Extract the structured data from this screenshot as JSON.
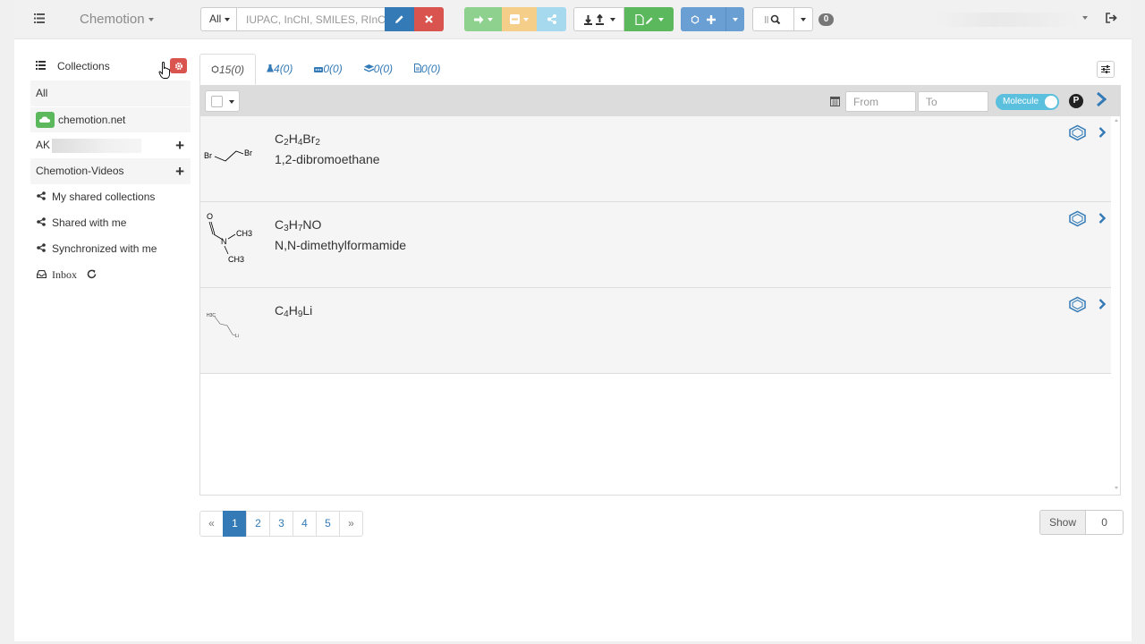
{
  "navbar": {
    "brand": "Chemotion",
    "search": {
      "scope": "All",
      "placeholder": "IUPAC, InChI, SMILES, RInChI..."
    },
    "notification_count": "0",
    "icons": {
      "menu": "menu-icon",
      "edit": "pencil-icon",
      "clear": "times-icon",
      "move": "arrow-right-icon",
      "remove": "minus-square-icon",
      "share": "share-icon",
      "import": "import-export-icon",
      "report": "file-pencil-icon",
      "create": "plus-icon",
      "search": "search-icon",
      "logout": "sign-out-icon"
    }
  },
  "sidebar": {
    "title": "Collections",
    "items": [
      {
        "label": "All"
      },
      {
        "label": "chemotion.net"
      },
      {
        "label": "AK"
      },
      {
        "label": "Chemotion-Videos"
      }
    ],
    "shared": [
      {
        "label": "My shared collections"
      },
      {
        "label": "Shared with me"
      },
      {
        "label": "Synchronized with me"
      }
    ],
    "inbox": "Inbox"
  },
  "tabs": [
    {
      "label": "15(0)",
      "icon": "sample-icon"
    },
    {
      "label": "4(0)",
      "icon": "reaction-icon"
    },
    {
      "label": "0(0)",
      "icon": "wellplate-icon"
    },
    {
      "label": "0(0)",
      "icon": "screen-icon"
    },
    {
      "label": "0(0)",
      "icon": "research-plan-icon"
    }
  ],
  "filter": {
    "from_placeholder": "From",
    "to_placeholder": "To",
    "toggle_label": "Molecule",
    "p_badge": "P"
  },
  "molecules": [
    {
      "formula": [
        [
          "C",
          ""
        ],
        [
          "",
          "2"
        ],
        [
          "H",
          ""
        ],
        [
          "",
          "4"
        ],
        [
          "Br",
          ""
        ],
        [
          "",
          "2"
        ]
      ],
      "name": "1,2-dibromoethane"
    },
    {
      "formula": [
        [
          "C",
          ""
        ],
        [
          "",
          "3"
        ],
        [
          "H",
          ""
        ],
        [
          "",
          "7"
        ],
        [
          "NO",
          ""
        ]
      ],
      "name": "N,N-dimethylformamide"
    },
    {
      "formula": [
        [
          "C",
          ""
        ],
        [
          "",
          "4"
        ],
        [
          "H",
          ""
        ],
        [
          "",
          "9"
        ],
        [
          "Li",
          ""
        ]
      ],
      "name": ""
    }
  ],
  "structure_labels": {
    "dbe": [
      "Br",
      "Br"
    ],
    "dmf": [
      "O",
      "N",
      "CH3",
      "CH3"
    ],
    "buli": [
      "H3C",
      "Li"
    ]
  },
  "pagination": [
    "«",
    "1",
    "2",
    "3",
    "4",
    "5",
    "»"
  ],
  "pagination_active": "1",
  "show": {
    "label": "Show",
    "value": "0"
  },
  "colors": {
    "primary": "#337ab7",
    "danger": "#d9534f",
    "success": "#5cb85c",
    "info": "#5bc0de"
  }
}
